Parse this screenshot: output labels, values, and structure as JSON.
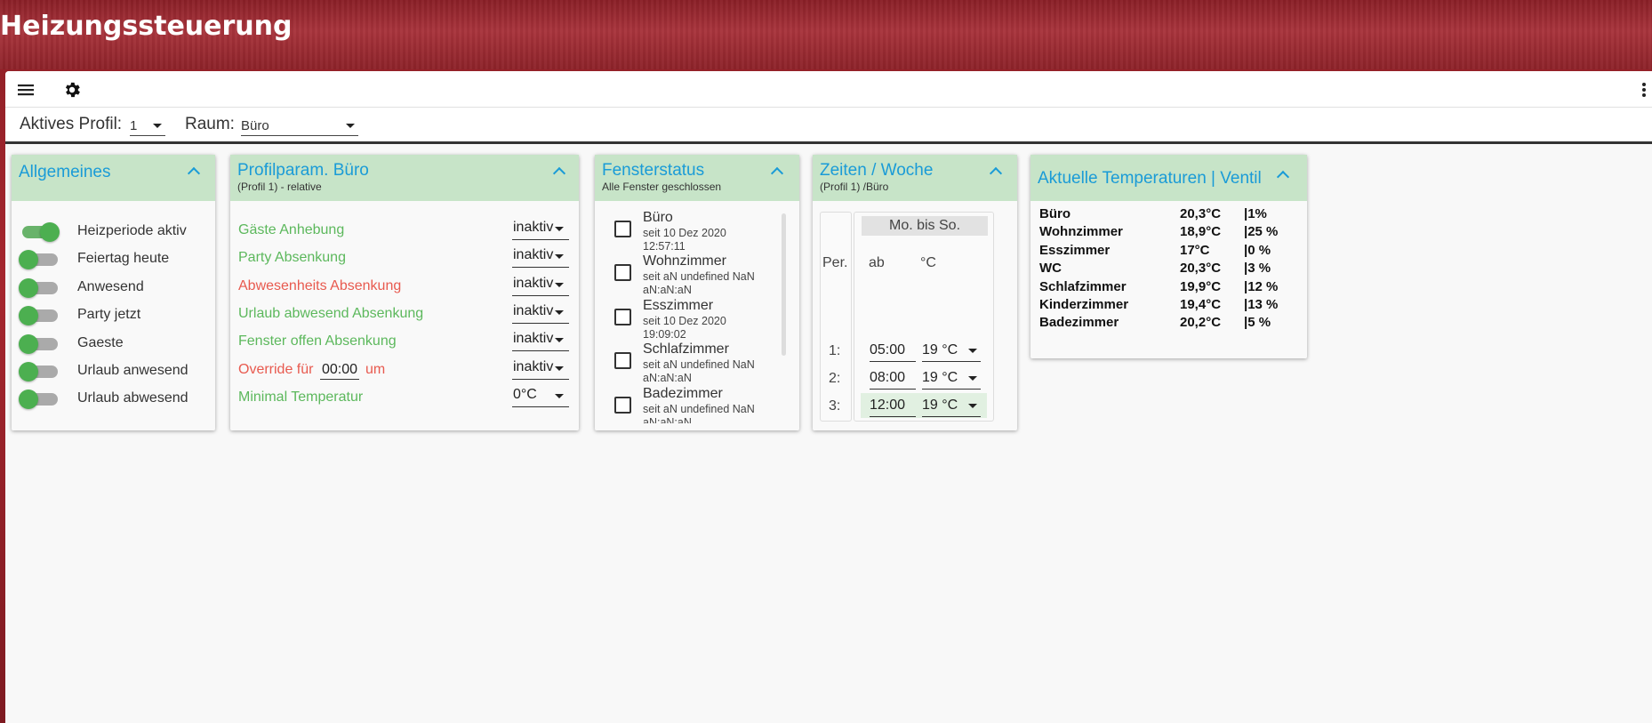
{
  "app": {
    "title": "Heizungssteuerung"
  },
  "toolbar": {
    "menu_icon": "menu-icon",
    "settings_icon": "gear-icon",
    "more_icon": "more-vert-icon"
  },
  "filter": {
    "profile_label": "Aktives Profil:",
    "profile_value": "1",
    "room_label": "Raum:",
    "room_value": "Büro"
  },
  "colors": {
    "accent": "#1a9bd7",
    "card_header": "#c7e4c8",
    "switch_green": "#4caf50",
    "label_green": "#5cb85c",
    "label_red": "#e85a4f",
    "background_red": "#9b2530"
  },
  "allgemeines": {
    "title": "Allgemeines",
    "items": [
      {
        "label": "Heizperiode aktiv",
        "on": true
      },
      {
        "label": "Feiertag heute",
        "on": false
      },
      {
        "label": "Anwesend",
        "on": false
      },
      {
        "label": "Party jetzt",
        "on": false
      },
      {
        "label": "Gaeste",
        "on": false
      },
      {
        "label": "Urlaub anwesend",
        "on": false
      },
      {
        "label": "Urlaub abwesend",
        "on": false
      }
    ]
  },
  "profilparam": {
    "title": "Profilparam. Büro",
    "subtitle": "(Profil 1) - relative",
    "rows": [
      {
        "label": "Gäste Anhebung",
        "color": "green",
        "value": "inaktiv"
      },
      {
        "label": "Party Absenkung",
        "color": "green",
        "value": "inaktiv"
      },
      {
        "label": "Abwesenheits Absenkung",
        "color": "red",
        "value": "inaktiv"
      },
      {
        "label": "Urlaub abwesend Absenkung",
        "color": "green",
        "value": "inaktiv"
      },
      {
        "label": "Fenster offen Absenkung",
        "color": "green",
        "value": "inaktiv"
      },
      {
        "label": "Override für",
        "time": "00:00",
        "suffix": "um",
        "color": "red",
        "value": "inaktiv"
      },
      {
        "label": "Minimal Temperatur",
        "color": "green",
        "value": "0°C"
      }
    ]
  },
  "fenster": {
    "title": "Fensterstatus",
    "subtitle": "Alle Fenster geschlossen",
    "items": [
      {
        "name": "Büro",
        "since": "seit 10 Dez 2020",
        "time": "12:57:11"
      },
      {
        "name": "Wohnzimmer",
        "since": "seit aN undefined NaN",
        "time": "aN:aN:aN"
      },
      {
        "name": "Esszimmer",
        "since": "seit 10 Dez 2020",
        "time": "19:09:02"
      },
      {
        "name": "Schlafzimmer",
        "since": "seit aN undefined NaN",
        "time": "aN:aN:aN"
      },
      {
        "name": "Badezimmer",
        "since": "seit aN undefined NaN",
        "time": "aN:aN:aN"
      }
    ]
  },
  "zeiten": {
    "title": "Zeiten / Woche",
    "subtitle": "(Profil 1) /Büro",
    "tab": "Mo. bis So.",
    "col_per": "Per.",
    "col_ab": "ab",
    "col_temp": "°C",
    "periods": [
      {
        "num": "1:",
        "time": "05:00",
        "temp": "19 °C"
      },
      {
        "num": "2:",
        "time": "08:00",
        "temp": "19 °C"
      },
      {
        "num": "3:",
        "time": "12:00",
        "temp": "19 °C"
      }
    ]
  },
  "temps": {
    "title": "Aktuelle Temperaturen | Ventil",
    "rows": [
      {
        "room": "Büro",
        "temp": "20,3°C",
        "valve": "|1%"
      },
      {
        "room": "Wohnzimmer",
        "temp": "18,9°C",
        "valve": "|25 %"
      },
      {
        "room": "Esszimmer",
        "temp": "17°C",
        "valve": "|0 %"
      },
      {
        "room": "WC",
        "temp": "20,3°C",
        "valve": "|3 %"
      },
      {
        "room": "Schlafzimmer",
        "temp": "19,9°C",
        "valve": "|12 %"
      },
      {
        "room": "Kinderzimmer",
        "temp": "19,4°C",
        "valve": "|13 %"
      },
      {
        "room": "Badezimmer",
        "temp": "20,2°C",
        "valve": "|5 %"
      }
    ]
  }
}
